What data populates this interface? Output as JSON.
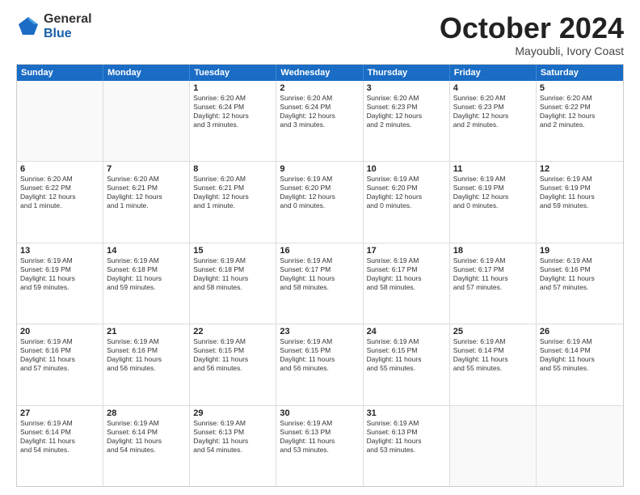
{
  "logo": {
    "general": "General",
    "blue": "Blue"
  },
  "title": "October 2024",
  "location": "Mayoubli, Ivory Coast",
  "header_days": [
    "Sunday",
    "Monday",
    "Tuesday",
    "Wednesday",
    "Thursday",
    "Friday",
    "Saturday"
  ],
  "weeks": [
    [
      {
        "day": "",
        "text": ""
      },
      {
        "day": "",
        "text": ""
      },
      {
        "day": "1",
        "text": "Sunrise: 6:20 AM\nSunset: 6:24 PM\nDaylight: 12 hours\nand 3 minutes."
      },
      {
        "day": "2",
        "text": "Sunrise: 6:20 AM\nSunset: 6:24 PM\nDaylight: 12 hours\nand 3 minutes."
      },
      {
        "day": "3",
        "text": "Sunrise: 6:20 AM\nSunset: 6:23 PM\nDaylight: 12 hours\nand 2 minutes."
      },
      {
        "day": "4",
        "text": "Sunrise: 6:20 AM\nSunset: 6:23 PM\nDaylight: 12 hours\nand 2 minutes."
      },
      {
        "day": "5",
        "text": "Sunrise: 6:20 AM\nSunset: 6:22 PM\nDaylight: 12 hours\nand 2 minutes."
      }
    ],
    [
      {
        "day": "6",
        "text": "Sunrise: 6:20 AM\nSunset: 6:22 PM\nDaylight: 12 hours\nand 1 minute."
      },
      {
        "day": "7",
        "text": "Sunrise: 6:20 AM\nSunset: 6:21 PM\nDaylight: 12 hours\nand 1 minute."
      },
      {
        "day": "8",
        "text": "Sunrise: 6:20 AM\nSunset: 6:21 PM\nDaylight: 12 hours\nand 1 minute."
      },
      {
        "day": "9",
        "text": "Sunrise: 6:19 AM\nSunset: 6:20 PM\nDaylight: 12 hours\nand 0 minutes."
      },
      {
        "day": "10",
        "text": "Sunrise: 6:19 AM\nSunset: 6:20 PM\nDaylight: 12 hours\nand 0 minutes."
      },
      {
        "day": "11",
        "text": "Sunrise: 6:19 AM\nSunset: 6:19 PM\nDaylight: 12 hours\nand 0 minutes."
      },
      {
        "day": "12",
        "text": "Sunrise: 6:19 AM\nSunset: 6:19 PM\nDaylight: 11 hours\nand 59 minutes."
      }
    ],
    [
      {
        "day": "13",
        "text": "Sunrise: 6:19 AM\nSunset: 6:19 PM\nDaylight: 11 hours\nand 59 minutes."
      },
      {
        "day": "14",
        "text": "Sunrise: 6:19 AM\nSunset: 6:18 PM\nDaylight: 11 hours\nand 59 minutes."
      },
      {
        "day": "15",
        "text": "Sunrise: 6:19 AM\nSunset: 6:18 PM\nDaylight: 11 hours\nand 58 minutes."
      },
      {
        "day": "16",
        "text": "Sunrise: 6:19 AM\nSunset: 6:17 PM\nDaylight: 11 hours\nand 58 minutes."
      },
      {
        "day": "17",
        "text": "Sunrise: 6:19 AM\nSunset: 6:17 PM\nDaylight: 11 hours\nand 58 minutes."
      },
      {
        "day": "18",
        "text": "Sunrise: 6:19 AM\nSunset: 6:17 PM\nDaylight: 11 hours\nand 57 minutes."
      },
      {
        "day": "19",
        "text": "Sunrise: 6:19 AM\nSunset: 6:16 PM\nDaylight: 11 hours\nand 57 minutes."
      }
    ],
    [
      {
        "day": "20",
        "text": "Sunrise: 6:19 AM\nSunset: 6:16 PM\nDaylight: 11 hours\nand 57 minutes."
      },
      {
        "day": "21",
        "text": "Sunrise: 6:19 AM\nSunset: 6:16 PM\nDaylight: 11 hours\nand 56 minutes."
      },
      {
        "day": "22",
        "text": "Sunrise: 6:19 AM\nSunset: 6:15 PM\nDaylight: 11 hours\nand 56 minutes."
      },
      {
        "day": "23",
        "text": "Sunrise: 6:19 AM\nSunset: 6:15 PM\nDaylight: 11 hours\nand 56 minutes."
      },
      {
        "day": "24",
        "text": "Sunrise: 6:19 AM\nSunset: 6:15 PM\nDaylight: 11 hours\nand 55 minutes."
      },
      {
        "day": "25",
        "text": "Sunrise: 6:19 AM\nSunset: 6:14 PM\nDaylight: 11 hours\nand 55 minutes."
      },
      {
        "day": "26",
        "text": "Sunrise: 6:19 AM\nSunset: 6:14 PM\nDaylight: 11 hours\nand 55 minutes."
      }
    ],
    [
      {
        "day": "27",
        "text": "Sunrise: 6:19 AM\nSunset: 6:14 PM\nDaylight: 11 hours\nand 54 minutes."
      },
      {
        "day": "28",
        "text": "Sunrise: 6:19 AM\nSunset: 6:14 PM\nDaylight: 11 hours\nand 54 minutes."
      },
      {
        "day": "29",
        "text": "Sunrise: 6:19 AM\nSunset: 6:13 PM\nDaylight: 11 hours\nand 54 minutes."
      },
      {
        "day": "30",
        "text": "Sunrise: 6:19 AM\nSunset: 6:13 PM\nDaylight: 11 hours\nand 53 minutes."
      },
      {
        "day": "31",
        "text": "Sunrise: 6:19 AM\nSunset: 6:13 PM\nDaylight: 11 hours\nand 53 minutes."
      },
      {
        "day": "",
        "text": ""
      },
      {
        "day": "",
        "text": ""
      }
    ]
  ]
}
